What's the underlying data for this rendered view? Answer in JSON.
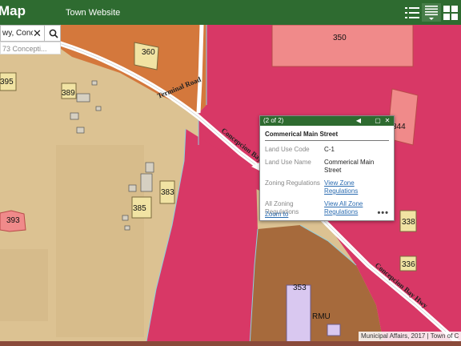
{
  "header": {
    "app_title": "Map",
    "site_link": "Town Website",
    "buttons": [
      {
        "name": "legend-list-icon"
      },
      {
        "name": "layer-list-icon"
      },
      {
        "name": "basemap-gallery-icon"
      }
    ]
  },
  "search": {
    "value": "wy, Conce",
    "suggestion": "73 Concepti..."
  },
  "map": {
    "parcel_labels": [
      "350",
      "360",
      "395",
      "389",
      "344",
      "383",
      "385",
      "393",
      "338",
      "336",
      "353",
      "RMU"
    ],
    "road_labels": [
      "Terminal Road",
      "Concepcion Bay",
      "Concepcion Bay Hwy"
    ],
    "colors": {
      "commercial": "#d83866",
      "residential": "#dcc292",
      "brown_zone": "#a66a3c",
      "orange_zone": "#d4783c",
      "road": "#ffffff",
      "building_salmon": "#f08a8a",
      "building_yellow": "#f1e3a3",
      "building_lavender": "#d9c8f0"
    }
  },
  "popup": {
    "counter": "(2 of 2)",
    "title": "Commerical Main Street",
    "fields": [
      {
        "key": "Land Use Code",
        "value": "C-1"
      },
      {
        "key": "Land Use Name",
        "value": "Commerical Main Street"
      },
      {
        "key": "Zoning Regulations",
        "value": "View Zone Regulations"
      },
      {
        "key": "All Zoning Regulations",
        "value": "View All Zone Regulations"
      }
    ],
    "zoom_label": "Zoom to",
    "more_label": "•••"
  },
  "attribution": "Municipal Affairs, 2017 | Town of C"
}
